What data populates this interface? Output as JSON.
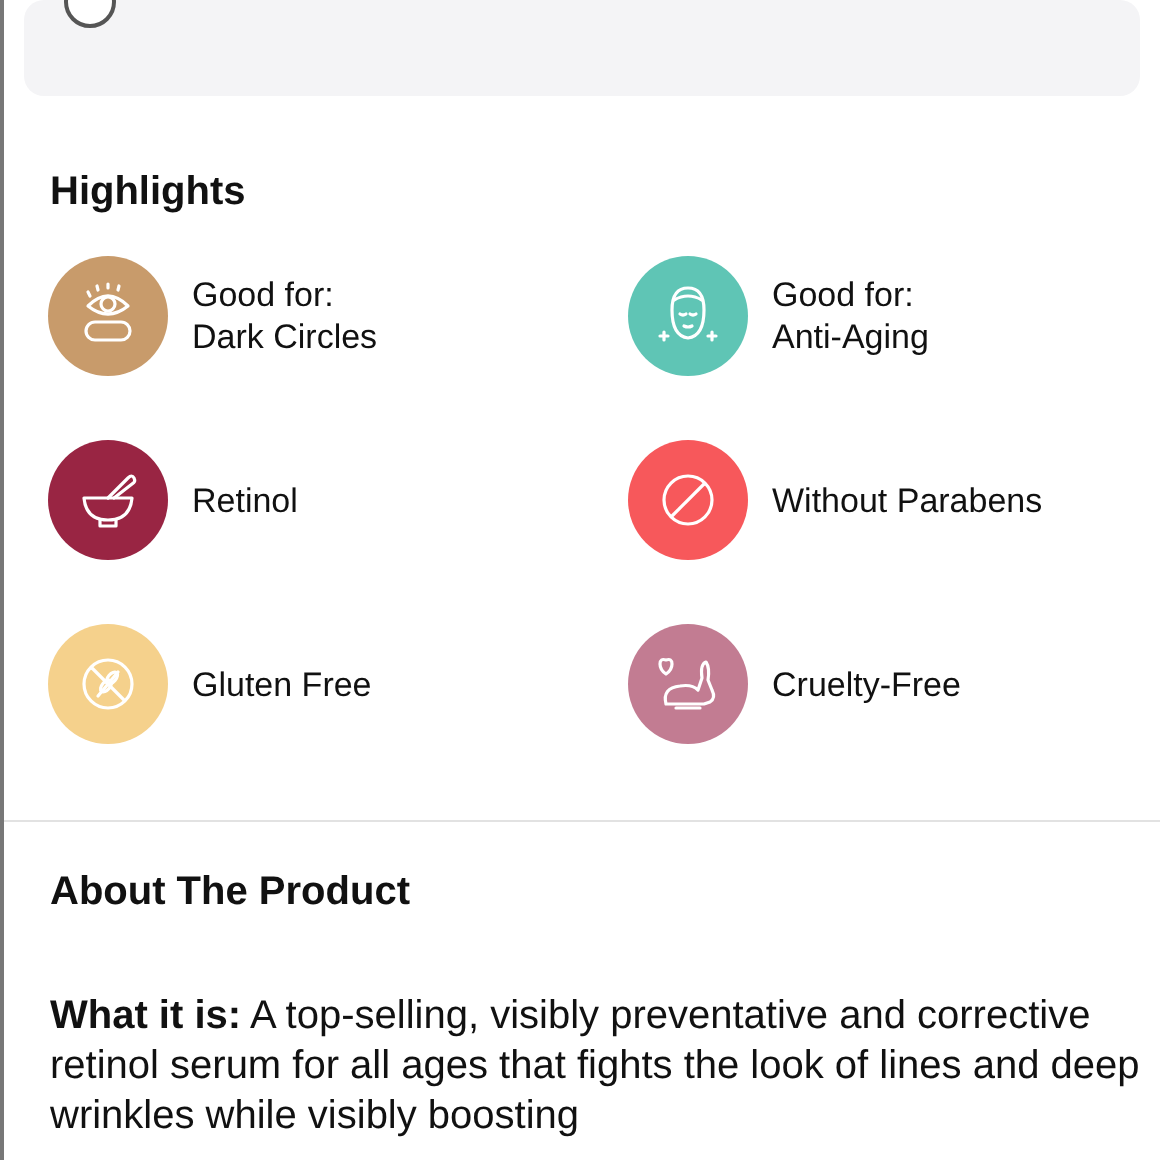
{
  "store_card": {
    "selected": false
  },
  "highlights": {
    "title": "Highlights",
    "items": [
      {
        "kind": "eye",
        "color": "#c89b6b",
        "lines": [
          "Good for:",
          "Dark Circles"
        ]
      },
      {
        "kind": "face",
        "color": "#5fc5b5",
        "lines": [
          "Good for:",
          "Anti-Aging"
        ]
      },
      {
        "kind": "bowl",
        "color": "#992543",
        "lines": [
          "Retinol"
        ]
      },
      {
        "kind": "ban",
        "color": "#f7585b",
        "lines": [
          "Without Parabens"
        ]
      },
      {
        "kind": "wheat",
        "color": "#f5d18c",
        "lines": [
          "Gluten Free"
        ]
      },
      {
        "kind": "rabbit",
        "color": "#c27c92",
        "lines": [
          "Cruelty-Free"
        ]
      }
    ]
  },
  "about": {
    "title": "About The Product",
    "text": "**What it is:** A top-selling, visibly preventative and corrective retinol serum for all ages that fights the look of lines and deep wrinkles while visibly boosting"
  }
}
